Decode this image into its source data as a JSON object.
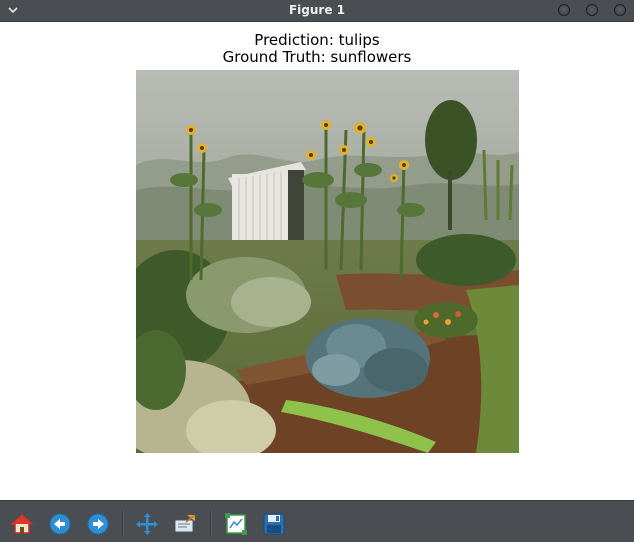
{
  "window": {
    "title": "Figure 1"
  },
  "plot": {
    "title_line1": "Prediction: tulips",
    "title_line2": "Ground Truth: sunflowers"
  },
  "toolbar": {
    "tools": [
      {
        "name": "home",
        "icon": "home-icon"
      },
      {
        "name": "back",
        "icon": "back-arrow-icon"
      },
      {
        "name": "forward",
        "icon": "forward-arrow-icon"
      },
      {
        "name": "pan",
        "icon": "pan-move-icon"
      },
      {
        "name": "zoom",
        "icon": "zoom-rectangle-icon"
      },
      {
        "name": "configure-subplots",
        "icon": "subplots-config-icon"
      },
      {
        "name": "save",
        "icon": "save-floppy-icon"
      }
    ]
  },
  "colors": {
    "chrome": "#4a4d52",
    "accent_blue": "#2f8fd6"
  }
}
